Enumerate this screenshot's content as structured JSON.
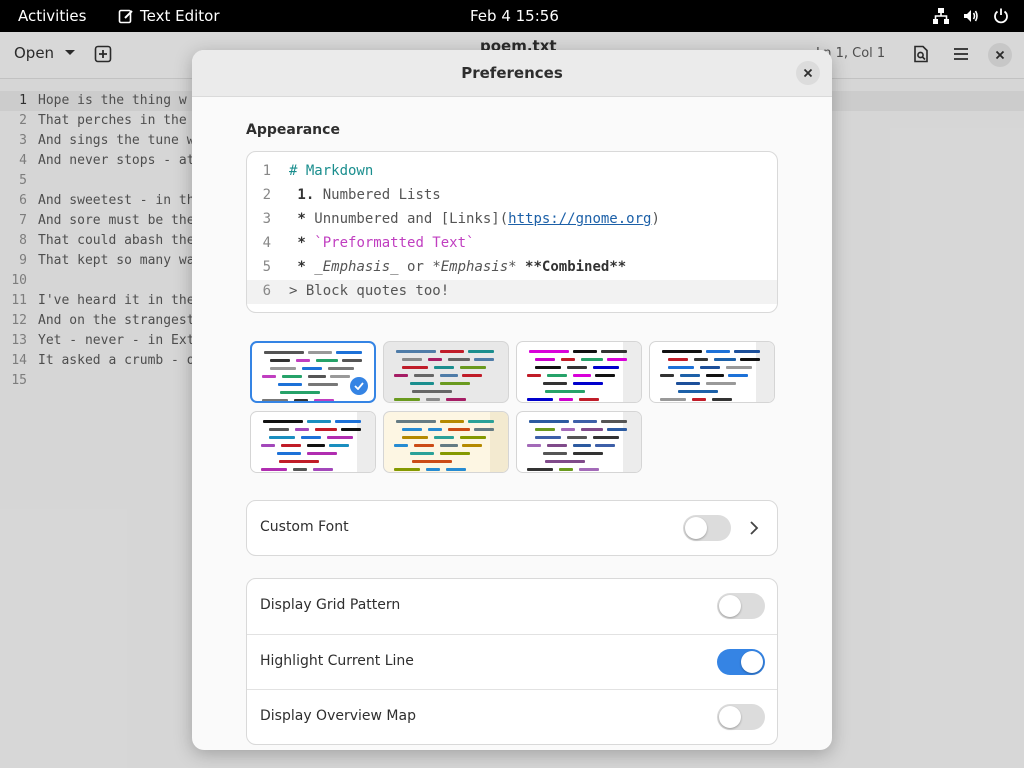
{
  "topbar": {
    "activities": "Activities",
    "app_name": "Text Editor",
    "clock": "Feb 4  15:56"
  },
  "editor": {
    "open_label": "Open",
    "title": "poem.txt",
    "cursor_position": "Ln 1, Col 1",
    "lines": [
      "Hope is the thing w",
      "That perches in the",
      "And sings the tune w",
      "And never stops - at",
      "",
      "And sweetest - in th",
      "And sore must be the",
      "That could abash the",
      "That kept so many wa",
      "",
      "I've heard it in the",
      "And on the strangest",
      "Yet - never - in Ext",
      "It asked a crumb - o",
      ""
    ]
  },
  "dialog": {
    "title": "Preferences",
    "section_title": "Appearance",
    "preview_lines": [
      {
        "num": "1",
        "segments": [
          {
            "cls": "md-head",
            "text": "# Markdown"
          }
        ]
      },
      {
        "num": "2",
        "segments": [
          {
            "cls": "md-bold",
            "text": " 1."
          },
          {
            "cls": "",
            "text": " Numbered Lists"
          }
        ]
      },
      {
        "num": "3",
        "segments": [
          {
            "cls": "md-bold",
            "text": " *"
          },
          {
            "cls": "",
            "text": " Unnumbered and [Links]("
          },
          {
            "cls": "md-link",
            "text": "https://gnome.org"
          },
          {
            "cls": "",
            "text": ")"
          }
        ]
      },
      {
        "num": "4",
        "segments": [
          {
            "cls": "md-bold",
            "text": " *"
          },
          {
            "cls": "",
            "text": " "
          },
          {
            "cls": "md-code",
            "text": "`Preformatted Text`"
          }
        ]
      },
      {
        "num": "5",
        "segments": [
          {
            "cls": "md-bold",
            "text": " *"
          },
          {
            "cls": "",
            "text": " "
          },
          {
            "cls": "md-ital",
            "text": "_Emphasis_"
          },
          {
            "cls": "",
            "text": " or "
          },
          {
            "cls": "md-ital",
            "text": "*Emphasis*"
          },
          {
            "cls": "",
            "text": " "
          },
          {
            "cls": "md-bold",
            "text": "**Combined**"
          }
        ]
      },
      {
        "num": "6",
        "segments": [
          {
            "cls": "",
            "text": "> Block quotes too!"
          }
        ]
      }
    ],
    "schemes": [
      {
        "bg": "#ffffff",
        "strip": "",
        "selected": true,
        "colors": [
          "#555555",
          "#333333",
          "#999999",
          "#c03ec0",
          "#1c71d8",
          "#26a269",
          "#777777"
        ]
      },
      {
        "bg": "#e8e8e8",
        "strip": "",
        "selected": false,
        "colors": [
          "#6a9a1f",
          "#4f7ca8",
          "#8a8a8a",
          "#c01c28",
          "#a51d64",
          "#1a8e8e",
          "#666666"
        ]
      },
      {
        "bg": "#ffffff",
        "strip": "#ececec",
        "selected": false,
        "colors": [
          "#26a269",
          "#0000cc",
          "#d900d9",
          "#cc00cc",
          "#111111",
          "#c01c28",
          "#333333"
        ]
      },
      {
        "bg": "#ffffff",
        "strip": "#ececec",
        "selected": false,
        "colors": [
          "#1c4f9a",
          "#1c60a8",
          "#999999",
          "#111111",
          "#c01c28",
          "#1c71d8",
          "#333333"
        ]
      },
      {
        "bg": "#ffffff",
        "strip": "#ececec",
        "selected": false,
        "colors": [
          "#a347ba",
          "#1c71d8",
          "#c01c28",
          "#b02db0",
          "#111111",
          "#555555",
          "#1a8ebf"
        ]
      },
      {
        "bg": "#fdf6e3",
        "strip": "#f3ead0",
        "selected": false,
        "colors": [
          "#b58900",
          "#268bd2",
          "#2aa198",
          "#cb4b16",
          "#859900",
          "#657b83",
          "#268bd2"
        ]
      },
      {
        "bg": "#ffffff",
        "strip": "#ececec",
        "selected": false,
        "colors": [
          "#6a9a1f",
          "#3d5fa8",
          "#a36ab8",
          "#555555",
          "#804a8a",
          "#333333",
          "#2c5aa0"
        ]
      }
    ],
    "rows": {
      "custom_font": {
        "label": "Custom Font",
        "on": false
      },
      "grid_pattern": {
        "label": "Display Grid Pattern",
        "on": false
      },
      "highlight_line": {
        "label": "Highlight Current Line",
        "on": true
      },
      "overview_map": {
        "label": "Display Overview Map",
        "on": false
      }
    }
  }
}
